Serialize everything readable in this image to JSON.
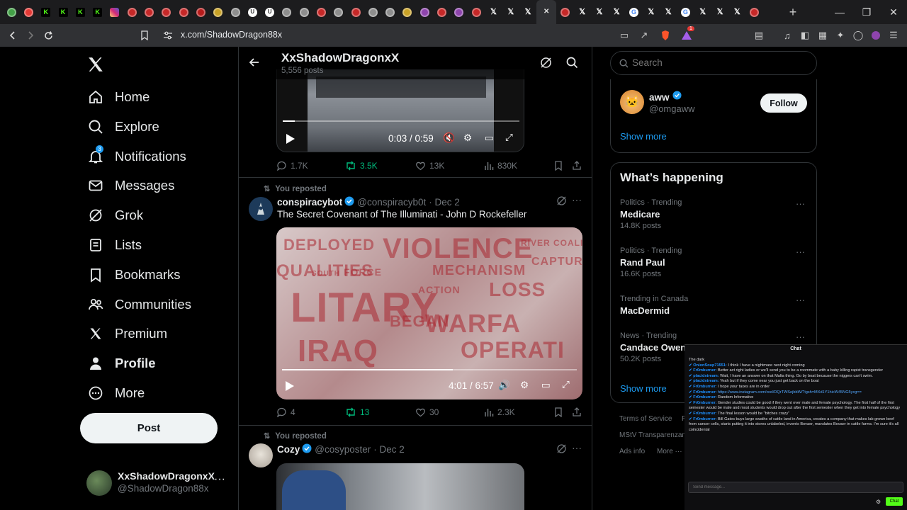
{
  "browser": {
    "url": "x.com/ShadowDragon88x",
    "tabs": [
      {
        "icon": "green-circle",
        "color": "#43a047",
        "active": false
      },
      {
        "icon": "red-circle",
        "color": "#e53935",
        "active": false
      },
      {
        "icon": "kick-icon",
        "color": "#53fc18",
        "active": false
      },
      {
        "icon": "kick-icon",
        "color": "#53fc18",
        "active": false
      },
      {
        "icon": "kick-icon",
        "color": "#53fc18",
        "active": false
      },
      {
        "icon": "kick-icon",
        "color": "#53fc18",
        "active": false
      },
      {
        "icon": "instagram-icon",
        "color": "#e1306c",
        "active": false
      },
      {
        "icon": "red-circle",
        "color": "#c62828",
        "active": false
      },
      {
        "icon": "red-circle",
        "color": "#c62828",
        "active": false
      },
      {
        "icon": "red-circle",
        "color": "#c62828",
        "active": false
      },
      {
        "icon": "red-circle",
        "color": "#c62828",
        "active": false
      },
      {
        "icon": "red-circle",
        "color": "#b71c1c",
        "active": false
      },
      {
        "icon": "yellow-circle",
        "color": "#c9a227",
        "active": false
      },
      {
        "icon": "gray-circle",
        "color": "#8e8e8e",
        "active": false
      },
      {
        "icon": "u-circle",
        "color": "#9e9e9e",
        "active": false
      },
      {
        "icon": "u-circle",
        "color": "#9e9e9e",
        "active": false
      },
      {
        "icon": "gray-circle",
        "color": "#8e8e8e",
        "active": false
      },
      {
        "icon": "gray-circle",
        "color": "#8e8e8e",
        "active": false
      },
      {
        "icon": "red-circle",
        "color": "#c62828",
        "active": false
      },
      {
        "icon": "gray-circle",
        "color": "#8e8e8e",
        "active": false
      },
      {
        "icon": "red-circle",
        "color": "#c62828",
        "active": false
      },
      {
        "icon": "gray-circle",
        "color": "#8e8e8e",
        "active": false
      },
      {
        "icon": "gray-circle",
        "color": "#8e8e8e",
        "active": false
      },
      {
        "icon": "yellow-circle",
        "color": "#c9a227",
        "active": false
      },
      {
        "icon": "purple-circle",
        "color": "#8e44ad",
        "active": false
      },
      {
        "icon": "red-circle",
        "color": "#c62828",
        "active": false
      },
      {
        "icon": "purple-circle",
        "color": "#8e44ad",
        "active": false
      },
      {
        "icon": "red-circle",
        "color": "#c62828",
        "active": false
      },
      {
        "icon": "x-icon",
        "color": "#000000",
        "active": false
      },
      {
        "icon": "x-icon",
        "color": "#000000",
        "active": false
      },
      {
        "icon": "x-icon",
        "color": "#000000",
        "active": false
      },
      {
        "icon": "close-icon",
        "color": "#303134",
        "active": true
      },
      {
        "icon": "red-circle",
        "color": "#c62828",
        "active": false
      },
      {
        "icon": "x-icon",
        "color": "#000000",
        "active": false
      },
      {
        "icon": "x-icon",
        "color": "#000000",
        "active": false
      },
      {
        "icon": "x-icon",
        "color": "#000000",
        "active": false
      },
      {
        "icon": "google-icon",
        "color": "#4285f4",
        "active": false
      },
      {
        "icon": "x-icon",
        "color": "#000000",
        "active": false
      },
      {
        "icon": "x-icon",
        "color": "#000000",
        "active": false
      },
      {
        "icon": "google-icon",
        "color": "#4285f4",
        "active": false
      },
      {
        "icon": "x-icon",
        "color": "#000000",
        "active": false
      },
      {
        "icon": "x-icon",
        "color": "#000000",
        "active": false
      },
      {
        "icon": "x-icon",
        "color": "#000000",
        "active": false
      },
      {
        "icon": "red-circle",
        "color": "#c62828",
        "active": false
      }
    ],
    "brave_badge": "1"
  },
  "nav": {
    "items": [
      {
        "label": "Home",
        "icon": "home-icon"
      },
      {
        "label": "Explore",
        "icon": "search-icon"
      },
      {
        "label": "Notifications",
        "icon": "bell-icon",
        "badge": "3"
      },
      {
        "label": "Messages",
        "icon": "envelope-icon"
      },
      {
        "label": "Grok",
        "icon": "grok-icon"
      },
      {
        "label": "Lists",
        "icon": "list-icon"
      },
      {
        "label": "Bookmarks",
        "icon": "bookmark-icon"
      },
      {
        "label": "Communities",
        "icon": "people-icon"
      },
      {
        "label": "Premium",
        "icon": "x-logo-icon"
      },
      {
        "label": "Profile",
        "icon": "person-icon"
      },
      {
        "label": "More",
        "icon": "more-circle-icon"
      }
    ],
    "post_label": "Post",
    "account": {
      "name": "XxShadowDragonxX",
      "handle": "@ShadowDragon88x"
    }
  },
  "header": {
    "title": "XxShadowDragonxX",
    "subtitle": "5,556 posts"
  },
  "post1": {
    "video": {
      "time": "0:03 / 0:59",
      "progress": 0.05
    },
    "stats": {
      "replies": "1.7K",
      "reposts": "3.5K",
      "likes": "13K",
      "views": "830K"
    }
  },
  "post2": {
    "reposted": "You reposted",
    "name": "conspiracybot",
    "handle": "@conspiracyb0t",
    "date": "· Dec 2",
    "text": "The Secret Covenant of The Illuminati - John D Rockefeller",
    "video": {
      "time": "4:01 / 6:57",
      "progress": 0.58,
      "overlay_words": [
        "DEPLOYED",
        "VIOLENCE",
        "QUALITIES",
        "FORCE",
        "MECHANISM",
        "LITARY",
        "LOSS",
        "WARFA",
        "OPERATI",
        "SOUTH",
        "BEGAN",
        "ACTION",
        "IRAQ",
        "RIVER COALITIE",
        "CAPTUR"
      ]
    },
    "stats": {
      "replies": "4",
      "reposts": "13",
      "likes": "30",
      "views": "2.3K"
    }
  },
  "post3": {
    "reposted": "You reposted",
    "name": "Cozy",
    "handle": "@cosyposter",
    "date": "· Dec 2"
  },
  "sidebar": {
    "search_placeholder": "Search",
    "follow_card": {
      "name": "aww",
      "handle": "@omgaww",
      "button": "Follow"
    },
    "show_more": "Show more",
    "happening_title": "What’s happening",
    "trends": [
      {
        "context": "Politics · Trending",
        "name": "Medicare",
        "posts": "14.8K posts"
      },
      {
        "context": "Politics · Trending",
        "name": "Rand Paul",
        "posts": "16.6K posts"
      },
      {
        "context": "Trending in Canada",
        "name": "MacDermid",
        "posts": ""
      },
      {
        "context": "News · Trending",
        "name": "Candace Owen",
        "posts": "50.2K posts"
      }
    ],
    "show_more2": "Show more",
    "footer": [
      "Terms of Service",
      "F",
      "MStV Transparenzang",
      "Ads info",
      "More ···"
    ]
  },
  "chat": {
    "title": "Chat",
    "messages": [
      {
        "user": "",
        "text": "The dark"
      },
      {
        "user": "OnionSoup71551:",
        "text": " I think I have a nightmare next night coming"
      },
      {
        "user": "Fr0mburner:",
        "text": " Better act right ladies or we'll send you to be a roommate with a baby killing rapist transgender"
      },
      {
        "user": "placidstream:",
        "text": " Wait, I have an answer on that Malta thing. Go by boat because the niggers can't swim."
      },
      {
        "user": "placidstream:",
        "text": " Yeah but if they come near you just get back on the boat"
      },
      {
        "user": "Fr0mburner:",
        "text": " I hope your taxes are in order"
      },
      {
        "user": "Fr0mburner:",
        "text": " https://www.instagram.com/reel/DQrTWSejbbW/?igsh=MXd1Y1hicW45NG5ycg=="
      },
      {
        "user": "Fr0mburner:",
        "text": " Random Informative"
      },
      {
        "user": "Fr0mburner:",
        "text": " Gender studies could be good if they went over male and female psychology. The first half of the first semester would be male and most students would drop out after the first semester when they get into female psychology"
      },
      {
        "user": "Fr0mburner:",
        "text": " The final lesson would be \"bitches crazy\""
      },
      {
        "user": "Fr0mburner:",
        "text": " Bill Gates buys large swaths of cattle land in America, creates a company that makes lab grown beef from cancer cells, starts putting it into stores unlabeled, invents Bovaer, mandates Bovaer in cattle farms. I'm sure it's all coincidental"
      }
    ],
    "input_placeholder": "Send message...",
    "send_label": "Chat"
  }
}
